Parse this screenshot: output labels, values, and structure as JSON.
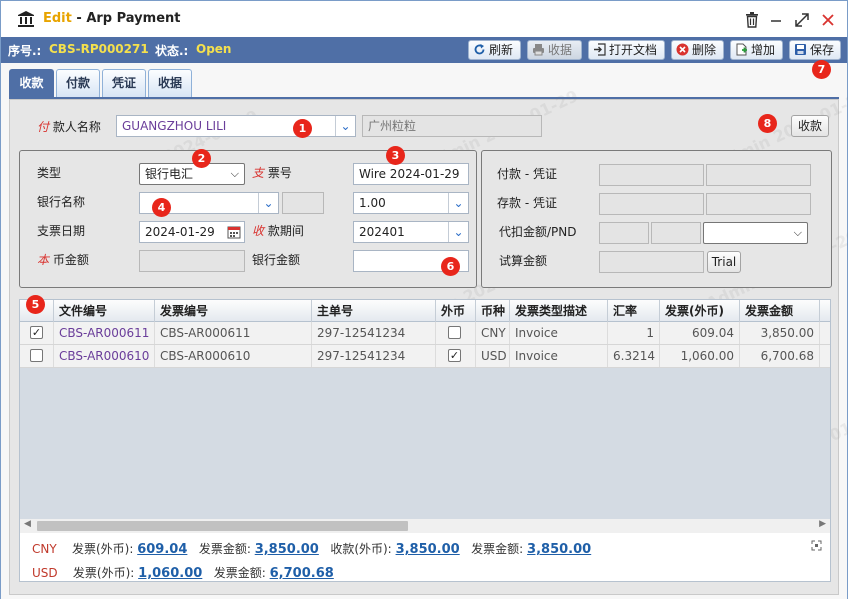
{
  "window": {
    "mode": "Edit",
    "separator": " - ",
    "title": "Arp Payment"
  },
  "infobar": {
    "seq_label": "序号.:",
    "seq_value": "CBS-RP000271",
    "status_label": "状态.:",
    "status_value": "Open"
  },
  "toolbar": {
    "refresh": "刷新",
    "receive": "收据",
    "open_doc": "打开文档",
    "delete": "删除",
    "add": "增加",
    "save": "保存"
  },
  "tabs": [
    "收款",
    "付款",
    "凭证",
    "收据"
  ],
  "payer": {
    "label_prefix": "付",
    "label": "款人名称",
    "value": "GUANGZHOU LILI",
    "alias": "广州粒粒",
    "collect_button": "收款"
  },
  "left": {
    "type_label": "类型",
    "type_value": "银行电汇",
    "cheque_label_prefix": "支",
    "cheque_label": "票号",
    "cheque_value": "Wire 2024-01-29",
    "bank_label": "银行名称",
    "bank_value": "",
    "rate_value": "1.00",
    "cheque_date_label": "支票日期",
    "cheque_date_value": "2024-01-29",
    "period_label_prefix": "收",
    "period_label": "款期间",
    "period_value": "202401",
    "local_amt_prefix": "本",
    "local_amt_label": "币金额",
    "bank_amt_label": "银行金额"
  },
  "right": {
    "pay_voucher_label": "付款 - 凭证",
    "deposit_voucher_label": "存款 - 凭证",
    "withhold_label": "代扣金额/PND",
    "trial_label": "试算金额",
    "trial_button": "Trial"
  },
  "grid": {
    "columns": [
      "文件编号",
      "发票编号",
      "主单号",
      "外币",
      "币种",
      "发票类型描述",
      "汇率",
      "发票(外币)",
      "发票金额"
    ],
    "rows": [
      {
        "checked": true,
        "doc_no": "CBS-AR000611",
        "inv_no": "CBS-AR000611",
        "master_no": "297-12541234",
        "foreign": false,
        "currency": "CNY",
        "inv_type": "Invoice",
        "rate": "1",
        "inv_foreign": "609.04",
        "inv_amount": "3,850.00"
      },
      {
        "checked": false,
        "doc_no": "CBS-AR000610",
        "inv_no": "CBS-AR000610",
        "master_no": "297-12541234",
        "foreign": true,
        "currency": "USD",
        "inv_type": "Invoice",
        "rate": "6.3214",
        "inv_foreign": "1,060.00",
        "inv_amount": "6,700.68"
      }
    ]
  },
  "summary": {
    "cny": {
      "currency": "CNY",
      "inv_foreign_label": "发票(外币):",
      "inv_foreign": "609.04",
      "inv_amount_label": "发票金额:",
      "inv_amount": "3,850.00",
      "received_label": "收款(外币):",
      "received": "3,850.00",
      "inv_amount2_label": "发票金额:",
      "inv_amount2": "3,850.00"
    },
    "usd": {
      "currency": "USD",
      "inv_foreign_label": "发票(外币):",
      "inv_foreign": "1,060.00",
      "inv_amount_label": "发票金额:",
      "inv_amount": "6,700.68"
    }
  },
  "watermark": "TLKA.CBS.Admin 2024-01-29",
  "badges": [
    "1",
    "2",
    "3",
    "4",
    "5",
    "6",
    "7",
    "8"
  ],
  "colors": {
    "accent": "#4f6fa6",
    "mode": "#e8a400",
    "badge": "#e8261b",
    "status": "#f4e04d",
    "link": "#1f5fa8"
  }
}
